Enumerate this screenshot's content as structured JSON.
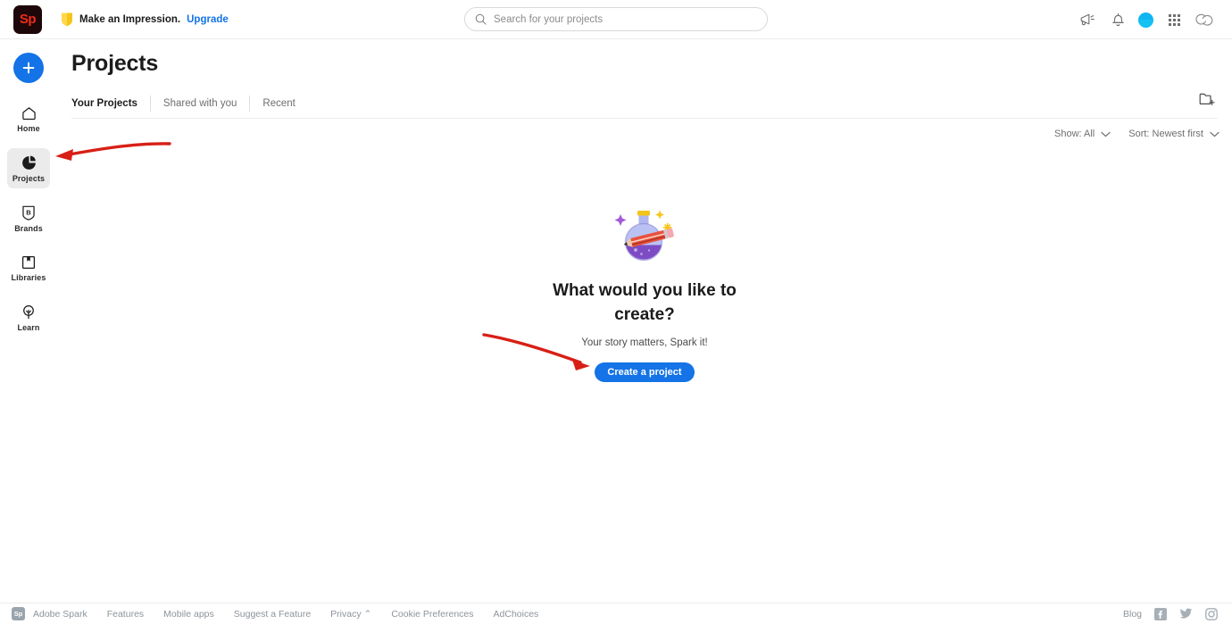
{
  "topbar": {
    "logo_text": "Sp",
    "promo_text": "Make an Impression.",
    "promo_link": "Upgrade",
    "icons": {
      "announcement": "megaphone-icon",
      "notifications": "bell-icon",
      "avatar": "user-avatar",
      "apps": "app-grid-icon",
      "creative_cloud": "creative-cloud-icon"
    }
  },
  "search": {
    "placeholder": "Search for your projects",
    "value": "",
    "icon": "search-icon"
  },
  "sidebar": {
    "create_button": "create-new-plus",
    "items": [
      {
        "label": "Home",
        "icon": "home-icon",
        "active": false
      },
      {
        "label": "Projects",
        "icon": "projects-icon",
        "active": true
      },
      {
        "label": "Brands",
        "icon": "brands-shield-icon",
        "active": false
      },
      {
        "label": "Libraries",
        "icon": "libraries-book-icon",
        "active": false
      },
      {
        "label": "Learn",
        "icon": "learn-lightbulb-icon",
        "active": false
      }
    ]
  },
  "main": {
    "title": "Projects",
    "tabs": [
      {
        "label": "Your Projects",
        "active": true
      },
      {
        "label": "Shared with you",
        "active": false
      },
      {
        "label": "Recent",
        "active": false
      }
    ],
    "new_folder_icon": "new-folder-icon",
    "filters": {
      "show_label": "Show: All",
      "sort_label": "Sort: Newest first"
    },
    "empty_state": {
      "illustration": "flask-and-pencil-illustration",
      "title": "What would you like to create?",
      "subtitle": "Your story matters, Spark it!",
      "button_label": "Create a project"
    }
  },
  "annotations": [
    {
      "name": "arrow-to-projects",
      "color": "#d81f16"
    },
    {
      "name": "arrow-to-create-project",
      "color": "#d81f16"
    }
  ],
  "footer": {
    "logo_text": "Sp",
    "links": [
      "Adobe Spark",
      "Features",
      "Mobile apps",
      "Suggest a Feature",
      "Privacy ⌃",
      "Cookie Preferences",
      "AdChoices"
    ],
    "blog_label": "Blog",
    "social": [
      "facebook-icon",
      "twitter-icon",
      "instagram-icon"
    ]
  },
  "colors": {
    "accent_blue": "#1473e6",
    "logo_red": "#f02c19",
    "annotation_red": "#d81f16"
  }
}
